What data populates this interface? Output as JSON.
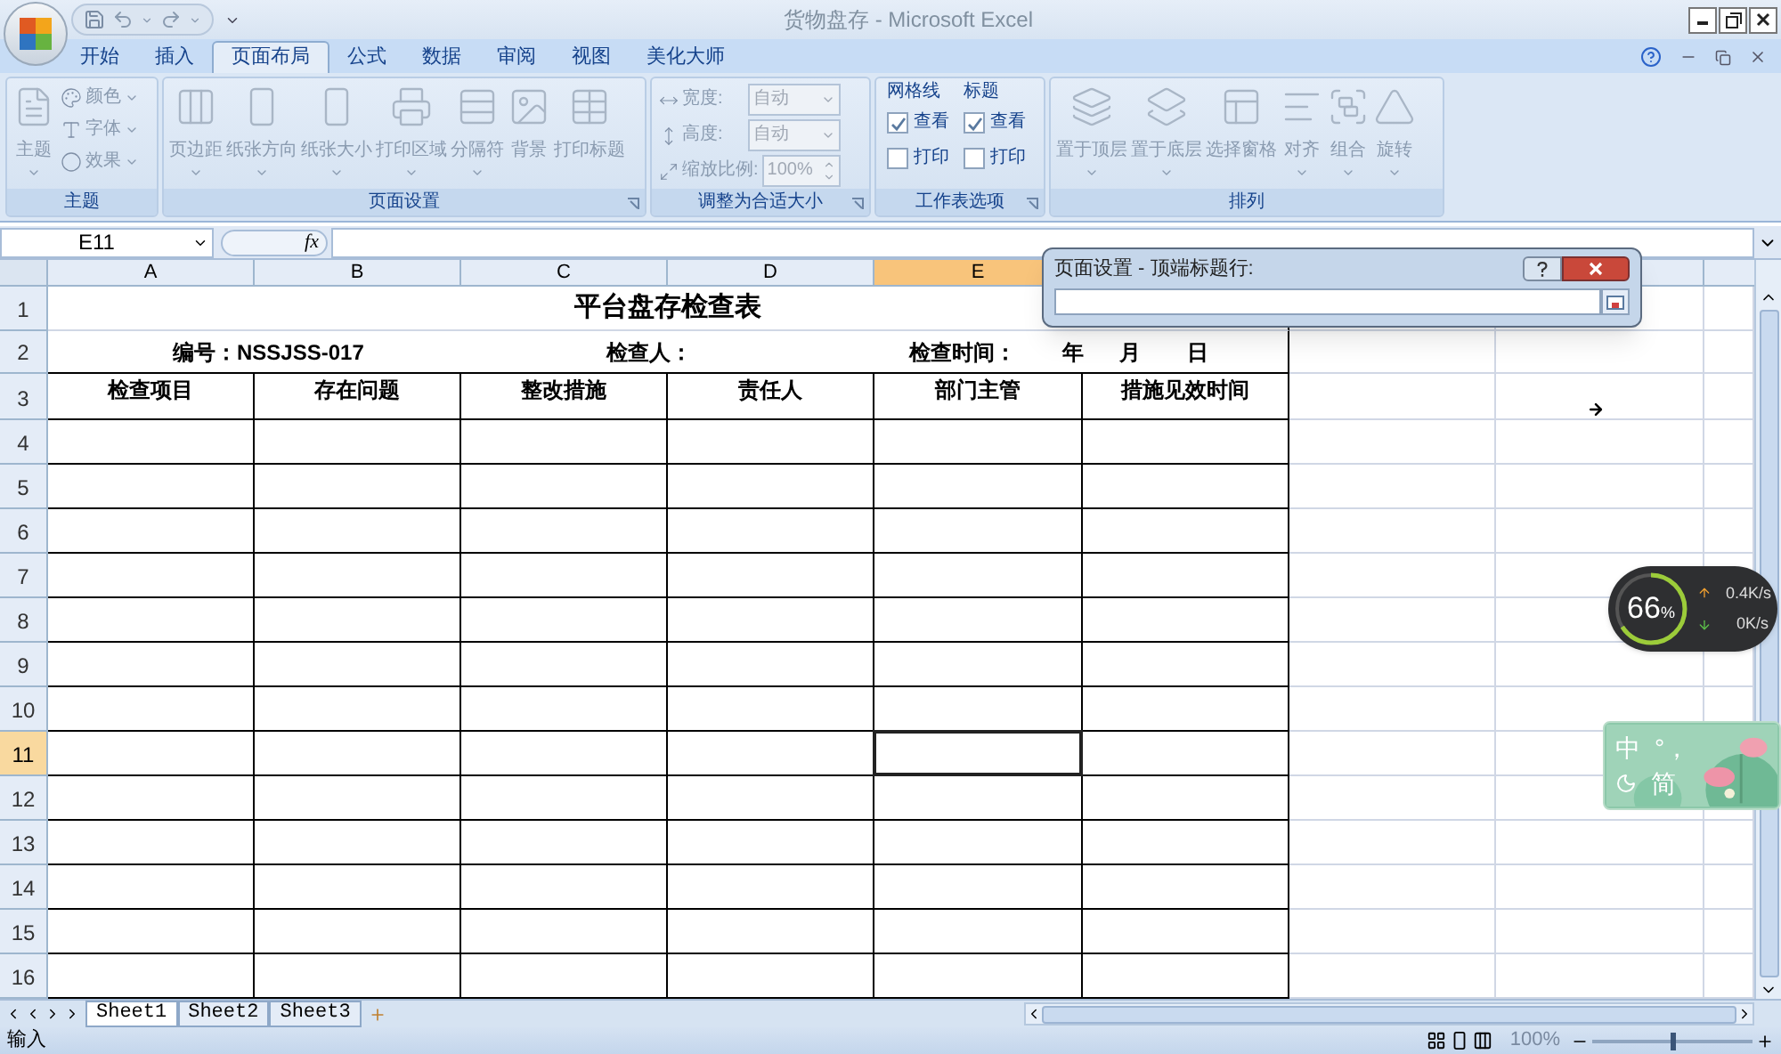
{
  "title_bar": {
    "title": "货物盘存 - Microsoft Excel"
  },
  "tabs": [
    {
      "label": "开始",
      "selected": false
    },
    {
      "label": "插入",
      "selected": false
    },
    {
      "label": "页面布局",
      "selected": true
    },
    {
      "label": "公式",
      "selected": false
    },
    {
      "label": "数据",
      "selected": false
    },
    {
      "label": "审阅",
      "selected": false
    },
    {
      "label": "视图",
      "selected": false
    },
    {
      "label": "美化大师",
      "selected": false
    }
  ],
  "ribbon": {
    "groups": [
      {
        "label": "主题",
        "launcher": false,
        "items": [
          {
            "kind": "large",
            "label": "主题",
            "dropdown": true,
            "disabled": true
          },
          {
            "kind": "small",
            "label": "颜色",
            "disabled": true
          },
          {
            "kind": "small",
            "label": "字体",
            "disabled": true
          },
          {
            "kind": "small",
            "label": "效果",
            "disabled": true
          }
        ]
      },
      {
        "label": "页面设置",
        "launcher": true,
        "items": [
          {
            "kind": "large",
            "label": "页边距",
            "dropdown": true,
            "disabled": true
          },
          {
            "kind": "large",
            "label": "纸张方向",
            "dropdown": true,
            "disabled": true
          },
          {
            "kind": "large",
            "label": "纸张大小",
            "dropdown": true,
            "disabled": true
          },
          {
            "kind": "large",
            "label": "打印区域",
            "dropdown": true,
            "disabled": true
          },
          {
            "kind": "large",
            "label": "分隔符",
            "dropdown": true,
            "disabled": true
          },
          {
            "kind": "large",
            "label": "背景",
            "dropdown": false,
            "disabled": true
          },
          {
            "kind": "large",
            "label": "打印标题",
            "dropdown": false,
            "disabled": true
          }
        ]
      },
      {
        "label": "调整为合适大小",
        "launcher": true,
        "items": [
          {
            "kind": "field",
            "label": "宽度:",
            "value": "自动",
            "disabled": true
          },
          {
            "kind": "field",
            "label": "高度:",
            "value": "自动",
            "disabled": true
          },
          {
            "kind": "spin",
            "label": "缩放比例:",
            "value": "100%",
            "disabled": true
          }
        ]
      },
      {
        "label": "工作表选项",
        "launcher": true,
        "items": [
          {
            "kind": "options",
            "label": "网格线",
            "disabled": false,
            "options": [
              {
                "label": "查看",
                "checked": true
              },
              {
                "label": "打印",
                "checked": false
              }
            ]
          },
          {
            "kind": "options",
            "label": "标题",
            "disabled": false,
            "options": [
              {
                "label": "查看",
                "checked": true
              },
              {
                "label": "打印",
                "checked": false
              }
            ]
          }
        ]
      },
      {
        "label": "排列",
        "launcher": false,
        "items": [
          {
            "kind": "large",
            "label": "置于顶层",
            "dropdown": true,
            "disabled": true
          },
          {
            "kind": "large",
            "label": "置于底层",
            "dropdown": true,
            "disabled": true
          },
          {
            "kind": "large",
            "label": "选择窗格",
            "dropdown": false,
            "disabled": true
          },
          {
            "kind": "large",
            "label": "对齐",
            "dropdown": true,
            "disabled": true
          },
          {
            "kind": "large",
            "label": "组合",
            "dropdown": true,
            "disabled": true
          },
          {
            "kind": "large",
            "label": "旋转",
            "dropdown": true,
            "disabled": true
          }
        ]
      }
    ]
  },
  "formula_bar": {
    "name_box": "E11",
    "fx": "fx"
  },
  "sheet": {
    "columns": [
      {
        "label": "A",
        "selected": false
      },
      {
        "label": "B",
        "selected": false
      },
      {
        "label": "C",
        "selected": false
      },
      {
        "label": "D",
        "selected": false
      },
      {
        "label": "E",
        "selected": true
      }
    ],
    "rows": [
      {
        "label": "1",
        "selected": false
      },
      {
        "label": "2",
        "selected": false
      },
      {
        "label": "3",
        "selected": false
      },
      {
        "label": "4",
        "selected": false
      },
      {
        "label": "5",
        "selected": false
      },
      {
        "label": "6",
        "selected": false
      },
      {
        "label": "7",
        "selected": false
      },
      {
        "label": "8",
        "selected": false
      },
      {
        "label": "9",
        "selected": false
      },
      {
        "label": "10",
        "selected": false
      },
      {
        "label": "11",
        "selected": true
      },
      {
        "label": "12",
        "selected": false
      },
      {
        "label": "13",
        "selected": false
      },
      {
        "label": "14",
        "selected": false
      },
      {
        "label": "15",
        "selected": false
      },
      {
        "label": "16",
        "selected": false
      }
    ],
    "title": "平台盘存检查表",
    "info": {
      "number": "编号：NSSJSS-017",
      "inspector": "检查人：",
      "time_label": "检查时间：",
      "year": "年",
      "month": "月",
      "day": "日"
    },
    "headers": [
      "检查项目",
      "存在问题",
      "整改措施",
      "责任人",
      "部门主管",
      "措施见效时间"
    ]
  },
  "dialog": {
    "title": "页面设置 - 顶端标题行:"
  },
  "sheet_tabs": [
    {
      "label": "Sheet1",
      "selected": true
    },
    {
      "label": "Sheet2",
      "selected": false
    },
    {
      "label": "Sheet3",
      "selected": false
    }
  ],
  "status_bar": {
    "mode": "输入",
    "zoom": "100%",
    "zoom_slider": {
      "level": 0.5
    }
  },
  "network_widget": {
    "percent": "66",
    "unit": "%",
    "level": 0.66,
    "upload": "0.4",
    "upload_unit": "K/s",
    "download": "0",
    "download_unit": "K/s"
  },
  "ime_widget": {
    "language": "中",
    "punctuation": "°，",
    "script": "简"
  }
}
